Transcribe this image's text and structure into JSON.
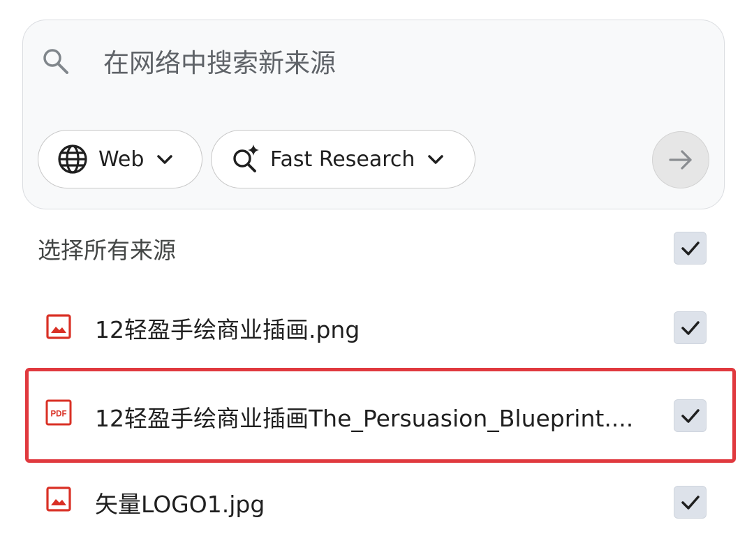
{
  "search": {
    "placeholder": "在网络中搜索新来源",
    "value": ""
  },
  "chips": {
    "source": {
      "label": "Web",
      "icon": "globe-icon"
    },
    "mode": {
      "label": "Fast Research",
      "icon": "sparkle-search-icon"
    }
  },
  "submit": {
    "icon": "arrow-right-icon"
  },
  "select_all": {
    "label": "选择所有来源",
    "checked": true
  },
  "sources": [
    {
      "name": "12轻盈手绘商业插画.png",
      "type": "image",
      "icon": "image-file-icon",
      "checked": true
    },
    {
      "name": "12轻盈手绘商业插画The_Persuasion_Blueprint....",
      "type": "pdf",
      "icon": "pdf-file-icon",
      "checked": true
    },
    {
      "name": "矢量LOGO1.jpg",
      "type": "image",
      "icon": "image-file-icon",
      "checked": true
    }
  ],
  "colors": {
    "file_icon": "#d93025",
    "highlight": "#e0393e",
    "checkbox_bg": "#dde2ea",
    "card_bg": "#f8f9fa"
  }
}
